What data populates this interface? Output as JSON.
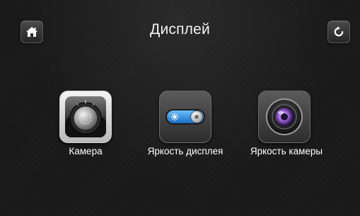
{
  "header": {
    "title": "Дисплей",
    "home_icon": "home-icon",
    "back_icon": "refresh-back-icon"
  },
  "items": [
    {
      "label": "Камера",
      "icon": "camera-dial-icon"
    },
    {
      "label": "Яркость дисплея",
      "icon": "brightness-toggle-icon"
    },
    {
      "label": "Яркость камеры",
      "icon": "camera-lens-icon"
    }
  ],
  "colors": {
    "background": "#1b1b1b",
    "toggle_blue": "#2d8fe6",
    "lens_purple": "#a86be0"
  }
}
